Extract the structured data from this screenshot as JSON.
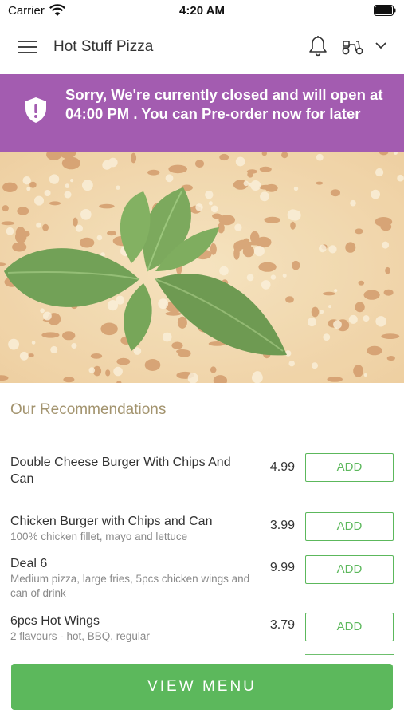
{
  "status_bar": {
    "carrier": "Carrier",
    "time": "4:20 AM"
  },
  "header": {
    "title": "Hot Stuff Pizza"
  },
  "banner": {
    "message": "Sorry, We're currently closed and will open at 04:00 PM . You can Pre-order now for later"
  },
  "recommendations": {
    "title": "Our Recommendations",
    "items": [
      {
        "name": "Double Cheese Burger With Chips And Can",
        "description": "",
        "price": "4.99",
        "button": "ADD"
      },
      {
        "name": "Chicken Burger with Chips and Can",
        "description": "100% chicken fillet, mayo and lettuce",
        "price": "3.99",
        "button": "ADD"
      },
      {
        "name": "Deal 6",
        "description": "Medium pizza, large fries, 5pcs chicken wings and can of drink",
        "price": "9.99",
        "button": "ADD"
      },
      {
        "name": "6pcs Hot Wings",
        "description": "2 flavours - hot, BBQ, regular",
        "price": "3.79",
        "button": "ADD"
      }
    ]
  },
  "footer": {
    "view_menu_label": "VIEW MENU"
  },
  "colors": {
    "banner": "#a35cb0",
    "accent_green": "#5cb85c",
    "section_title": "#a3946f"
  }
}
